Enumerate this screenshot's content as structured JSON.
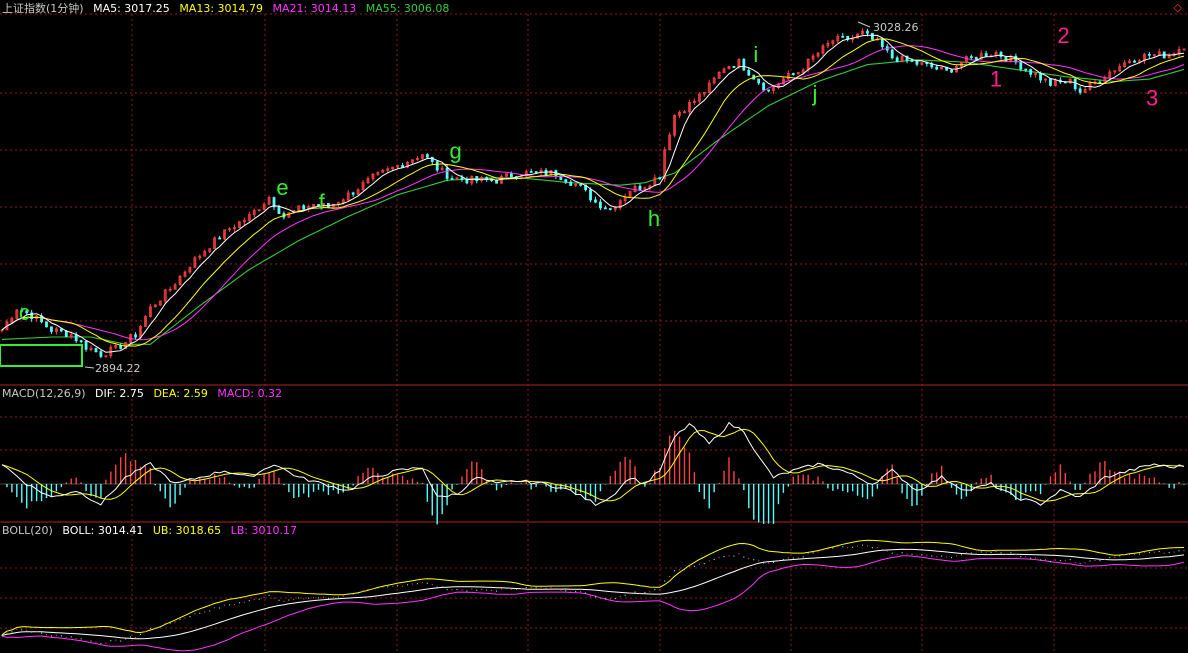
{
  "colors": {
    "background": "#000000",
    "grid": "#8a1c1c",
    "ma5": "#ffffff",
    "ma13": "#ffff00",
    "ma21": "#ff33ff",
    "ma55": "#33cc33",
    "candle_up": "#ff4040",
    "candle_down": "#54ffff",
    "green_label": "#33ee33",
    "pink_label": "#ff1e8c",
    "macd_pos": "#ff4040",
    "macd_neg": "#54ffff"
  },
  "header": {
    "title": "上证指数(1分钟)",
    "ma5": "MA5: 3017.25",
    "ma13": "MA13: 3014.79",
    "ma21": "MA21: 3014.13",
    "ma55": "MA55: 3006.08"
  },
  "macd_header": {
    "name": "MACD(12,26,9)",
    "dif": "DIF: 2.75",
    "dea": "DEA: 2.59",
    "macd": "MACD: 0.32"
  },
  "boll_header": {
    "name": "BOLL(20)",
    "boll": "BOLL: 3014.41",
    "ub": "UB: 3018.65",
    "lb": "LB: 3010.17"
  },
  "corner_icon": "diamond-icon",
  "chart_data": {
    "type": "line",
    "x_range": [
      0,
      240
    ],
    "price_ylim": [
      2885,
      3036
    ],
    "price_high_label": "3028.26",
    "price_low_label": "2894.22",
    "price_keypoints": [
      [
        0,
        2905
      ],
      [
        3,
        2914
      ],
      [
        6,
        2911
      ],
      [
        10,
        2905
      ],
      [
        14,
        2903
      ],
      [
        17,
        2898
      ],
      [
        20,
        2895
      ],
      [
        23,
        2897
      ],
      [
        27,
        2903
      ],
      [
        30,
        2914
      ],
      [
        34,
        2922
      ],
      [
        38,
        2932
      ],
      [
        42,
        2940
      ],
      [
        46,
        2947
      ],
      [
        50,
        2952
      ],
      [
        54,
        2960
      ],
      [
        57,
        2952
      ],
      [
        60,
        2955
      ],
      [
        63,
        2957
      ],
      [
        66,
        2956
      ],
      [
        70,
        2961
      ],
      [
        75,
        2968
      ],
      [
        80,
        2973
      ],
      [
        85,
        2978
      ],
      [
        88,
        2972
      ],
      [
        91,
        2968
      ],
      [
        95,
        2967
      ],
      [
        100,
        2967
      ],
      [
        104,
        2970
      ],
      [
        108,
        2970
      ],
      [
        112,
        2970
      ],
      [
        117,
        2964
      ],
      [
        120,
        2958
      ],
      [
        123,
        2955
      ],
      [
        127,
        2963
      ],
      [
        130,
        2965
      ],
      [
        133,
        2969
      ],
      [
        134,
        2980
      ],
      [
        136,
        2994
      ],
      [
        140,
        3000
      ],
      [
        143,
        3006
      ],
      [
        146,
        3014
      ],
      [
        149,
        3016
      ],
      [
        152,
        3010
      ],
      [
        155,
        3004
      ],
      [
        158,
        3009
      ],
      [
        161,
        3012
      ],
      [
        164,
        3018
      ],
      [
        168,
        3025
      ],
      [
        172,
        3026
      ],
      [
        174,
        3028
      ],
      [
        177,
        3024
      ],
      [
        180,
        3018
      ],
      [
        184,
        3016
      ],
      [
        188,
        3014
      ],
      [
        191,
        3012
      ],
      [
        194,
        3016
      ],
      [
        198,
        3019
      ],
      [
        201,
        3020
      ],
      [
        205,
        3016
      ],
      [
        208,
        3012
      ],
      [
        212,
        3007
      ],
      [
        216,
        3008
      ],
      [
        218,
        3004
      ],
      [
        220,
        3006
      ],
      [
        224,
        3012
      ],
      [
        228,
        3017
      ],
      [
        232,
        3019
      ],
      [
        236,
        3019
      ],
      [
        239,
        3023
      ]
    ],
    "ma55_keypoints": [
      [
        0,
        2901
      ],
      [
        10,
        2902
      ],
      [
        18,
        2902
      ],
      [
        25,
        2899
      ],
      [
        30,
        2899
      ],
      [
        40,
        2915
      ],
      [
        50,
        2930
      ],
      [
        60,
        2942
      ],
      [
        70,
        2952
      ],
      [
        80,
        2961
      ],
      [
        90,
        2967
      ],
      [
        98,
        2968
      ],
      [
        105,
        2968
      ],
      [
        115,
        2966
      ],
      [
        125,
        2965
      ],
      [
        130,
        2966
      ],
      [
        136,
        2970
      ],
      [
        145,
        2984
      ],
      [
        155,
        2998
      ],
      [
        165,
        3008
      ],
      [
        175,
        3015
      ],
      [
        185,
        3017
      ],
      [
        195,
        3016
      ],
      [
        205,
        3013
      ],
      [
        215,
        3010
      ],
      [
        225,
        3008
      ],
      [
        232,
        3009
      ],
      [
        239,
        3013
      ]
    ],
    "macd_ylim": [
      -6,
      12
    ],
    "dif_keypoints": [
      [
        0,
        3
      ],
      [
        5,
        0
      ],
      [
        10,
        -2
      ],
      [
        15,
        -1
      ],
      [
        20,
        -3
      ],
      [
        25,
        1
      ],
      [
        30,
        3
      ],
      [
        35,
        0
      ],
      [
        40,
        1
      ],
      [
        45,
        2
      ],
      [
        50,
        1
      ],
      [
        55,
        3
      ],
      [
        60,
        1
      ],
      [
        65,
        0
      ],
      [
        70,
        -1
      ],
      [
        75,
        1
      ],
      [
        80,
        2
      ],
      [
        85,
        2.5
      ],
      [
        88,
        -2
      ],
      [
        92,
        -1.5
      ],
      [
        96,
        1
      ],
      [
        100,
        0
      ],
      [
        104,
        0.5
      ],
      [
        110,
        0
      ],
      [
        115,
        -1
      ],
      [
        120,
        -3
      ],
      [
        123,
        -2
      ],
      [
        127,
        1
      ],
      [
        130,
        0
      ],
      [
        133,
        2
      ],
      [
        136,
        7
      ],
      [
        139,
        9
      ],
      [
        143,
        6
      ],
      [
        147,
        9
      ],
      [
        150,
        8
      ],
      [
        153,
        4
      ],
      [
        156,
        1
      ],
      [
        160,
        2
      ],
      [
        165,
        3
      ],
      [
        170,
        2
      ],
      [
        173,
        1
      ],
      [
        176,
        0
      ],
      [
        180,
        2
      ],
      [
        185,
        -1
      ],
      [
        190,
        1
      ],
      [
        195,
        -1
      ],
      [
        200,
        0
      ],
      [
        205,
        -2
      ],
      [
        210,
        -3
      ],
      [
        214,
        -1
      ],
      [
        218,
        -2
      ],
      [
        223,
        1
      ],
      [
        228,
        2
      ],
      [
        233,
        3
      ],
      [
        236,
        2.5
      ],
      [
        239,
        2.75
      ]
    ],
    "dea_keypoints": [
      [
        0,
        2
      ],
      [
        5,
        1
      ],
      [
        10,
        -1
      ],
      [
        15,
        -1.5
      ],
      [
        20,
        -2
      ],
      [
        25,
        -0.5
      ],
      [
        30,
        2
      ],
      [
        35,
        1
      ],
      [
        40,
        0.5
      ],
      [
        45,
        1.5
      ],
      [
        50,
        1.5
      ],
      [
        55,
        2
      ],
      [
        60,
        1.5
      ],
      [
        65,
        0.5
      ],
      [
        70,
        -0.5
      ],
      [
        75,
        0
      ],
      [
        80,
        1
      ],
      [
        85,
        2
      ],
      [
        88,
        0
      ],
      [
        92,
        -1
      ],
      [
        96,
        0
      ],
      [
        100,
        0
      ],
      [
        104,
        0.5
      ],
      [
        110,
        0
      ],
      [
        115,
        -0.5
      ],
      [
        120,
        -2
      ],
      [
        123,
        -2.5
      ],
      [
        127,
        -1
      ],
      [
        130,
        -0.5
      ],
      [
        133,
        0.5
      ],
      [
        136,
        3
      ],
      [
        139,
        6
      ],
      [
        143,
        6.5
      ],
      [
        147,
        7
      ],
      [
        150,
        7.5
      ],
      [
        153,
        5.5
      ],
      [
        156,
        3
      ],
      [
        160,
        2
      ],
      [
        165,
        2.5
      ],
      [
        170,
        2.5
      ],
      [
        173,
        1.5
      ],
      [
        176,
        1
      ],
      [
        180,
        1
      ],
      [
        185,
        0.5
      ],
      [
        190,
        0.5
      ],
      [
        195,
        0
      ],
      [
        200,
        0
      ],
      [
        205,
        -1
      ],
      [
        210,
        -2
      ],
      [
        214,
        -1.5
      ],
      [
        218,
        -1.5
      ],
      [
        223,
        0
      ],
      [
        228,
        1
      ],
      [
        233,
        2
      ],
      [
        236,
        2.6
      ],
      [
        239,
        2.59
      ]
    ],
    "boll_ylim": [
      2885,
      3036
    ],
    "point_labels": [
      {
        "text": "c",
        "x": 4,
        "y": 2909,
        "style": "green"
      },
      {
        "text": "e",
        "x": 65,
        "y": 2961,
        "style": "green"
      },
      {
        "text": "f",
        "x": 75,
        "y": 2955,
        "style": "green"
      },
      {
        "text": "g",
        "x": 106,
        "y": 2976,
        "style": "green"
      },
      {
        "text": "h",
        "x": 153,
        "y": 2948,
        "style": "green"
      },
      {
        "text": "i",
        "x": 178,
        "y": 3016,
        "style": "green"
      },
      {
        "text": "j",
        "x": 192,
        "y": 3000,
        "style": "green"
      },
      {
        "text": "1",
        "x": 234,
        "y": 3006,
        "style": "pink"
      },
      {
        "text": "2",
        "x": 250,
        "y": 3024,
        "style": "pink"
      },
      {
        "text": "3",
        "x": 271,
        "y": 2998,
        "style": "pink"
      }
    ]
  }
}
